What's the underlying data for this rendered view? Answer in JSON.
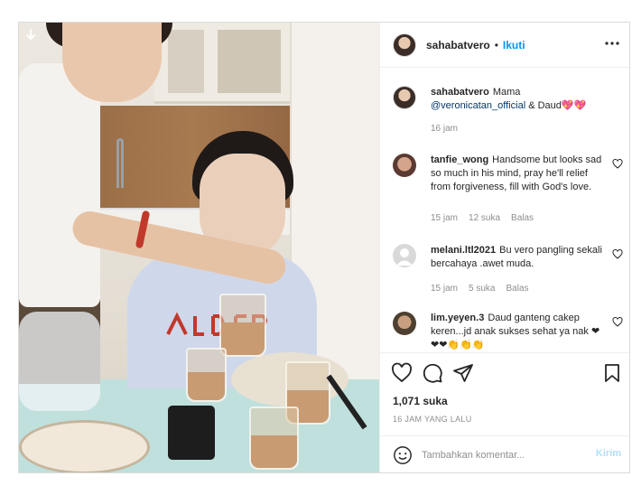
{
  "header": {
    "username": "sahabatvero",
    "separator": "•",
    "follow_label": "Ikuti",
    "more_icon": "more-horizontal-icon"
  },
  "caption": {
    "username": "sahabatvero",
    "text_before": "Mama",
    "mention": "@veronicatan_official",
    "text_after": "& Daud",
    "hearts": "💖💖",
    "time": "16 jam"
  },
  "comments": [
    {
      "username": "tanfie_wong",
      "text": "Handsome but looks sad so much in his mind, pray he'll relief from forgiveness, fill with God's love.",
      "time": "15 jam",
      "likes": "12 suka",
      "reply": "Balas"
    },
    {
      "username": "melani.ltl2021",
      "text": "Bu vero pangling sekali bercahaya .awet muda.",
      "time": "15 jam",
      "likes": "5 suka",
      "reply": "Balas"
    },
    {
      "username": "lim.yeyen.3",
      "text": "Daud ganteng cakep keren...jd anak sukses sehat ya nak",
      "emojis": "❤❤❤👏👏👏"
    }
  ],
  "actions": {
    "likes": "1,071 suka",
    "timestamp": "16 JAM YANG LALU"
  },
  "add_comment": {
    "placeholder": "Tambahkan komentar...",
    "post_label": "Kirim"
  },
  "colors": {
    "accent": "#0095f6",
    "link": "#00376b",
    "muted": "#8e8e8e",
    "post_disabled": "#b2dffc"
  }
}
